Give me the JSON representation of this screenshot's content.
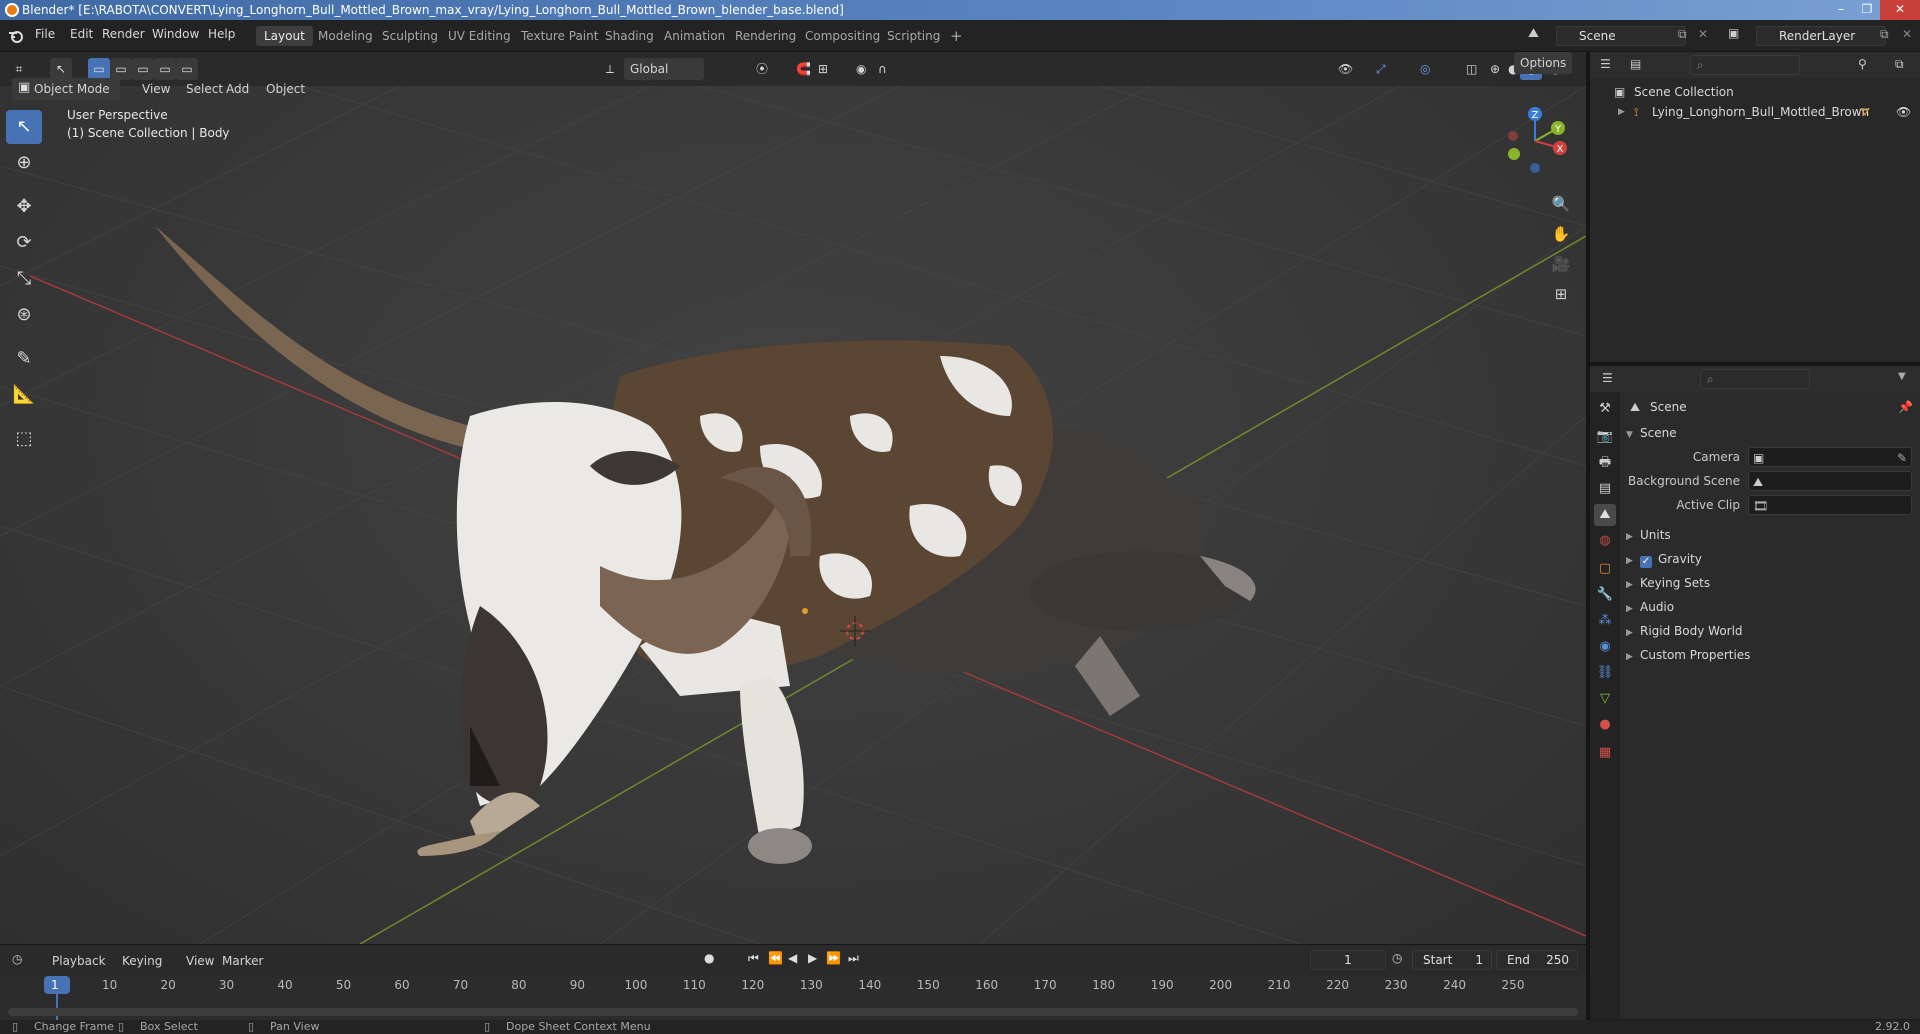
{
  "window": {
    "title": "Blender* [E:\\RABOTA\\CONVERT\\Lying_Longhorn_Bull_Mottled_Brown_max_vray/Lying_Longhorn_Bull_Mottled_Brown_blender_base.blend]",
    "min": "–",
    "max": "❐",
    "close": "✕"
  },
  "menu": [
    "File",
    "Edit",
    "Render",
    "Window",
    "Help"
  ],
  "workspaces": [
    "Layout",
    "Modeling",
    "Sculpting",
    "UV Editing",
    "Texture Paint",
    "Shading",
    "Animation",
    "Rendering",
    "Compositing",
    "Scripting"
  ],
  "workspace_add": "+",
  "scene_field": "Scene",
  "view_layer_field": "RenderLayer",
  "viewport_header": {
    "mode": "Object Mode",
    "menus": [
      "View",
      "Select",
      "Add",
      "Object"
    ],
    "orientation": "Global",
    "options": "Options"
  },
  "viewport": {
    "perspective": "User Perspective",
    "collection_info": "(1) Scene Collection | Body"
  },
  "gizmo": {
    "z": "Z",
    "y": "Y",
    "x": "X"
  },
  "outliner": {
    "root": "Scene Collection",
    "items": [
      {
        "label": "Lying_Longhorn_Bull_Mottled_Brown"
      }
    ]
  },
  "properties": {
    "context": "Scene",
    "panel_scene": "Scene",
    "fields": [
      {
        "label": "Camera"
      },
      {
        "label": "Background Scene"
      },
      {
        "label": "Active Clip"
      }
    ],
    "panels": [
      "Units",
      "Gravity",
      "Keying Sets",
      "Audio",
      "Rigid Body World",
      "Custom Properties"
    ],
    "gravity_checked": true
  },
  "timeline": {
    "menus": [
      "Playback",
      "Keying",
      "View",
      "Marker"
    ],
    "current_frame": "1",
    "start_label": "Start",
    "start": "1",
    "end_label": "End",
    "end": "250",
    "ticks": [
      "1",
      "10",
      "20",
      "30",
      "40",
      "50",
      "60",
      "70",
      "80",
      "90",
      "100",
      "110",
      "120",
      "130",
      "140",
      "150",
      "160",
      "170",
      "180",
      "190",
      "200",
      "210",
      "220",
      "230",
      "240",
      "250"
    ]
  },
  "statusbar": {
    "items": [
      "Change Frame",
      "Box Select",
      "Pan View",
      "Dope Sheet Context Menu"
    ],
    "version": "2.92.0"
  },
  "colors": {
    "accent": "#4772b3",
    "x_axis": "#d1423f",
    "y_axis": "#8ab429",
    "z_axis": "#3b7ed8"
  }
}
